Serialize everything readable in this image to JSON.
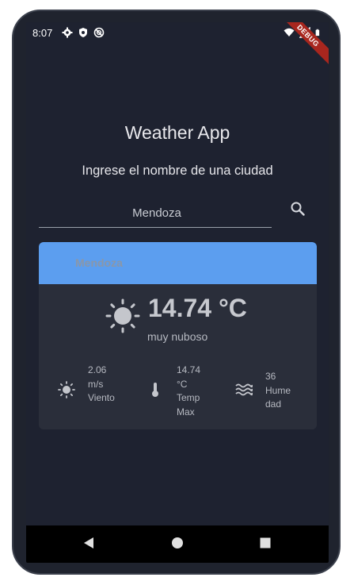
{
  "status_bar": {
    "time": "8:07",
    "left_icons": [
      "gear-icon",
      "shield-icon",
      "location-off-icon"
    ],
    "right_icons": [
      "wifi-icon",
      "signal-icon",
      "battery-icon"
    ],
    "debug_label": "DEBUG"
  },
  "app": {
    "title": "Weather App",
    "prompt": "Ingrese el nombre de una ciudad",
    "search": {
      "value": "Mendoza",
      "placeholder": ""
    }
  },
  "weather": {
    "city": "Mendoza",
    "temperature": "14.74 °C",
    "description": "muy nuboso",
    "stats": [
      {
        "icon": "sun-icon",
        "value": "2.06 m/s",
        "label": "Viento"
      },
      {
        "icon": "thermometer-icon",
        "value": "14.74 °C",
        "label": "Temp Max"
      },
      {
        "icon": "waves-icon",
        "value": "36",
        "label": "Humedad"
      }
    ]
  },
  "colors": {
    "background": "#1e2230",
    "accent": "#5c9eef",
    "card": "#2a2e3a",
    "debug_ribbon": "#a8261e"
  },
  "nav_buttons": [
    "back-icon",
    "home-icon",
    "recents-icon"
  ]
}
